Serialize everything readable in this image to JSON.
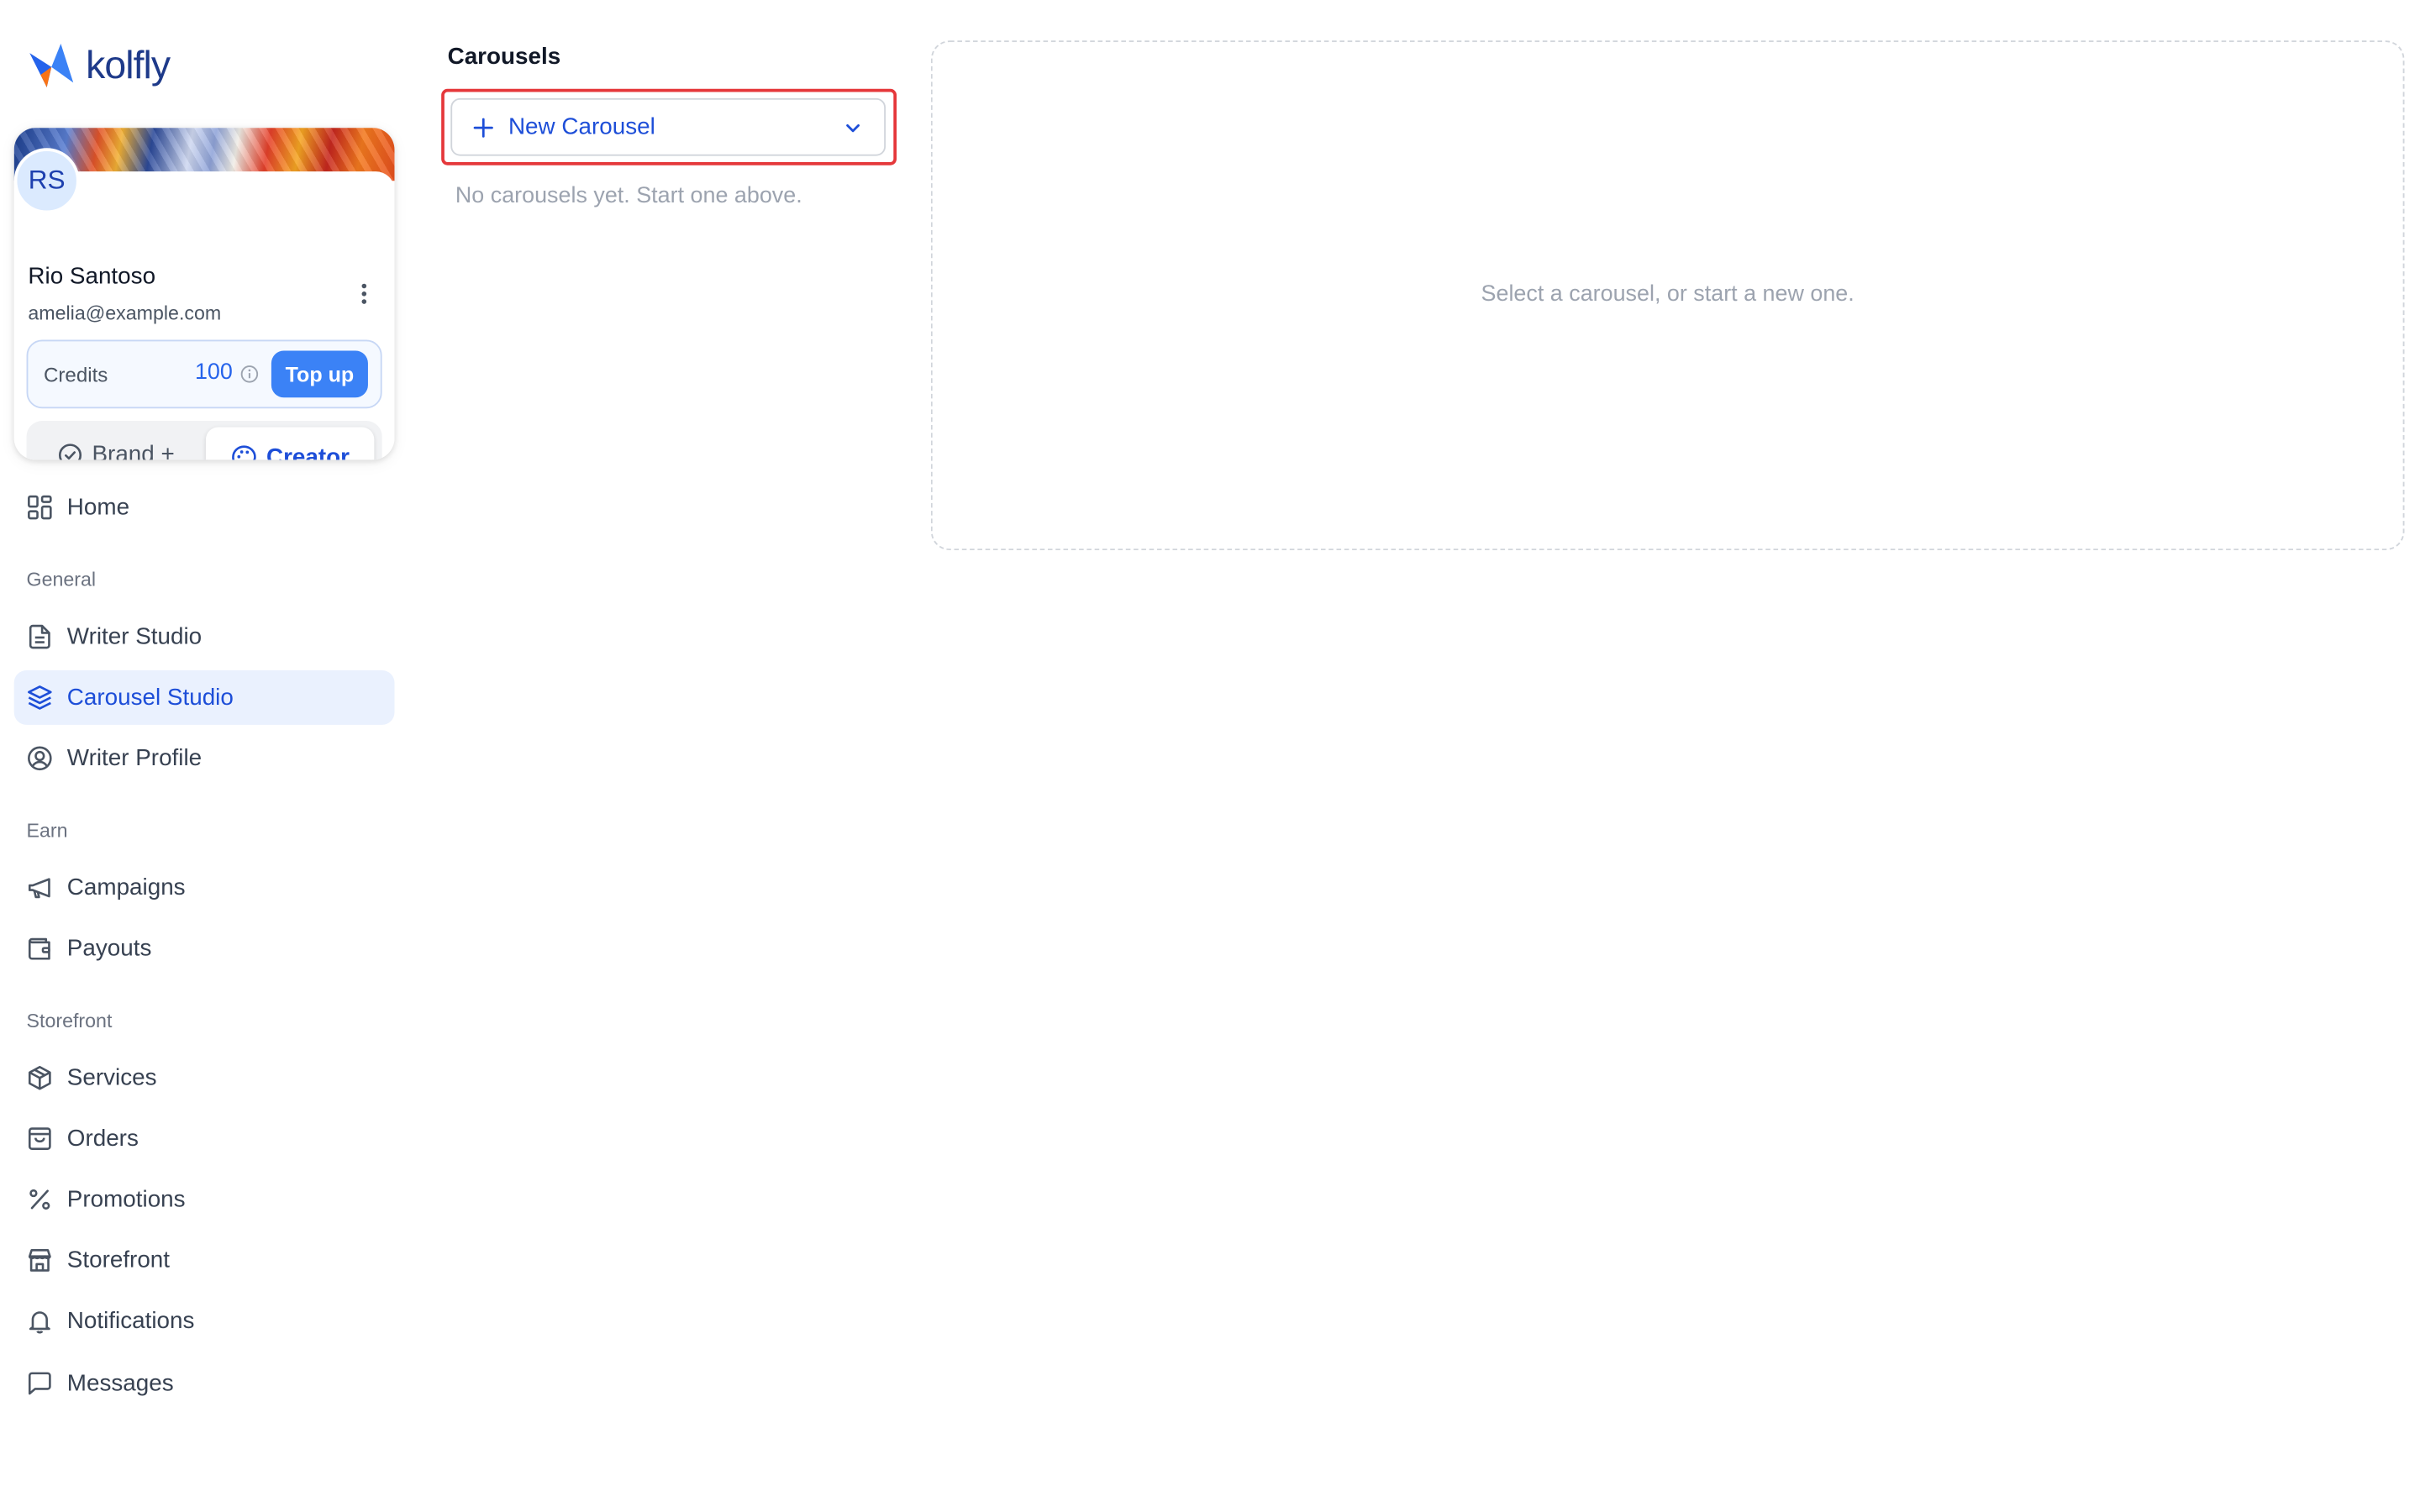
{
  "app": {
    "name": "kolfly",
    "accent": "#2563eb"
  },
  "profile": {
    "initials": "RS",
    "name": "Rio Santoso",
    "email": "amelia@example.com",
    "credits_label": "Credits",
    "credits_value": "100",
    "topup_label": "Top up",
    "mode_brand_label": "Brand +",
    "mode_creator_label": "Creator",
    "active_mode": "Creator"
  },
  "nav": {
    "home": "Home",
    "section_general": "General",
    "writer_studio": "Writer Studio",
    "carousel_studio": "Carousel Studio",
    "writer_profile": "Writer Profile",
    "section_earn": "Earn",
    "campaigns": "Campaigns",
    "payouts": "Payouts",
    "section_storefront": "Storefront",
    "services": "Services",
    "orders": "Orders",
    "promotions": "Promotions",
    "storefront": "Storefront",
    "notifications": "Notifications",
    "messages": "Messages",
    "active": "Carousel Studio"
  },
  "carousels": {
    "title": "Carousels",
    "new_button_label": "New Carousel",
    "empty_text": "No carousels yet. Start one above."
  },
  "preview": {
    "empty_text": "Select a carousel, or start a new one."
  },
  "icons": {
    "logo": "kolfly-bird-logo",
    "home": "grid-icon",
    "writer_studio": "document-icon",
    "carousel_studio": "layers-icon",
    "writer_profile": "user-circle-icon",
    "campaigns": "megaphone-icon",
    "payouts": "wallet-icon",
    "services": "box-icon",
    "orders": "shopping-bag-icon",
    "promotions": "percent-icon",
    "storefront": "store-icon",
    "notifications": "bell-icon",
    "messages": "message-square-icon"
  }
}
